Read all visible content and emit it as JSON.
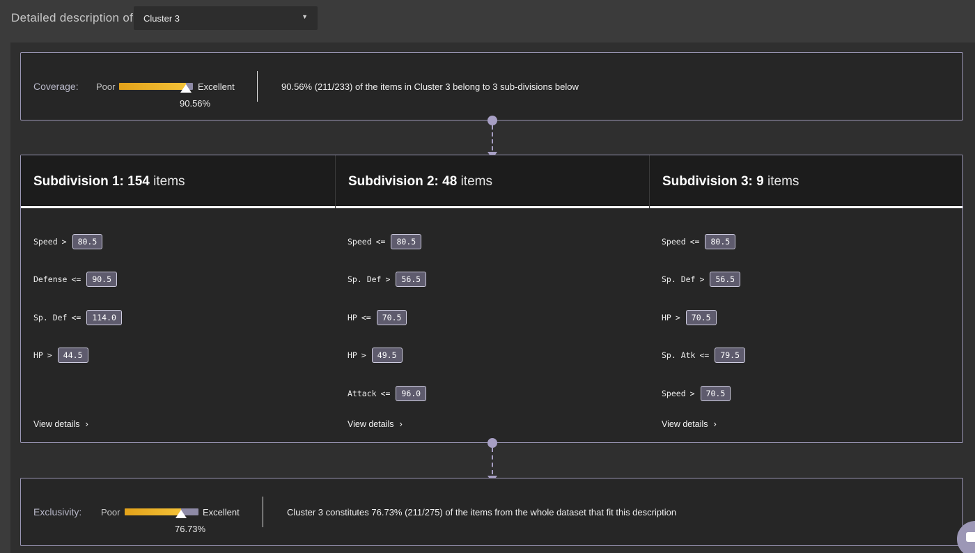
{
  "header": {
    "label": "Detailed description of",
    "select_value": "Cluster 3"
  },
  "coverage": {
    "name": "Coverage:",
    "poor": "Poor",
    "excellent": "Excellent",
    "value_fraction": 0.9056,
    "pct_text": "90.56%",
    "description": "90.56% (211/233) of the items in Cluster 3 belong to 3 sub-divisions below"
  },
  "subdivisions": [
    {
      "title": "Subdivision 1:",
      "count": "154",
      "items_word": "items",
      "rules": [
        {
          "feature": "Speed",
          "op": ">",
          "value": "80.5"
        },
        {
          "feature": "Defense",
          "op": "<=",
          "value": "90.5"
        },
        {
          "feature": "Sp. Def",
          "op": "<=",
          "value": "114.0"
        },
        {
          "feature": "HP",
          "op": ">",
          "value": "44.5"
        }
      ],
      "view_label": "View details"
    },
    {
      "title": "Subdivision 2:",
      "count": "48",
      "items_word": "items",
      "rules": [
        {
          "feature": "Speed",
          "op": "<=",
          "value": "80.5"
        },
        {
          "feature": "Sp. Def",
          "op": ">",
          "value": "56.5"
        },
        {
          "feature": "HP",
          "op": "<=",
          "value": "70.5"
        },
        {
          "feature": "HP",
          "op": ">",
          "value": "49.5"
        },
        {
          "feature": "Attack",
          "op": "<=",
          "value": "96.0"
        }
      ],
      "view_label": "View details"
    },
    {
      "title": "Subdivision 3:",
      "count": "9",
      "items_word": "items",
      "rules": [
        {
          "feature": "Speed",
          "op": "<=",
          "value": "80.5"
        },
        {
          "feature": "Sp. Def",
          "op": ">",
          "value": "56.5"
        },
        {
          "feature": "HP",
          "op": ">",
          "value": "70.5"
        },
        {
          "feature": "Sp. Atk",
          "op": "<=",
          "value": "79.5"
        },
        {
          "feature": "Speed",
          "op": ">",
          "value": "70.5"
        }
      ],
      "view_label": "View details"
    }
  ],
  "exclusivity": {
    "name": "Exclusivity:",
    "poor": "Poor",
    "excellent": "Excellent",
    "value_fraction": 0.7673,
    "pct_text": "76.73%",
    "description": "Cluster 3 constitutes 76.73% (211/275) of the items from the whole dataset that fit this description"
  },
  "icons": {
    "select_caret": "caret-down-icon",
    "view_chevron": "chevron-right-icon",
    "chat": "chat-icon"
  },
  "colors": {
    "accent_bar": "#f0b429",
    "connector": "#a79fc4",
    "chip_bg": "#5e5b6d"
  }
}
